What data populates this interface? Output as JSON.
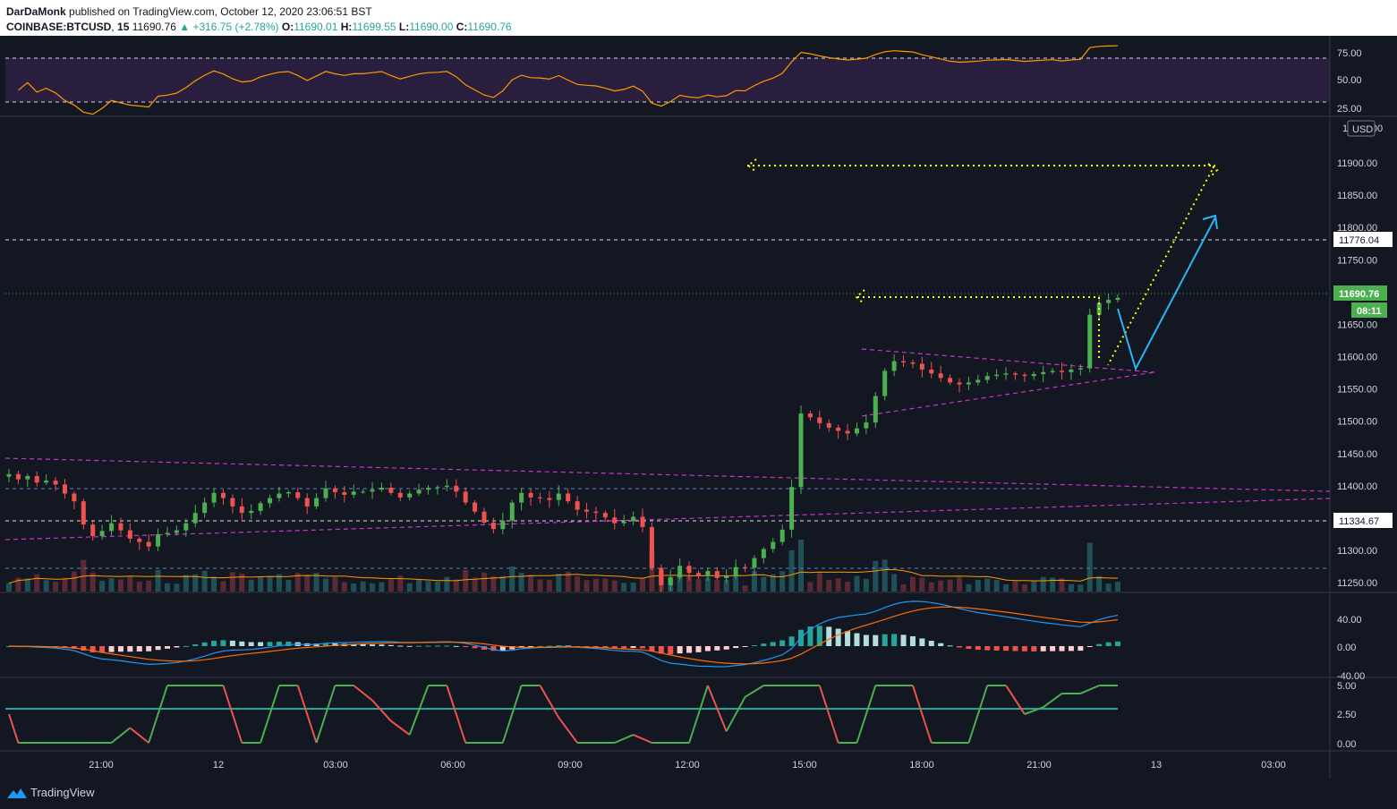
{
  "header": {
    "author": "DarDaMonk",
    "published_text": "published on TradingView.com, October 12, 2020 23:06:51 BST",
    "symbol": "COINBASE:BTCUSD",
    "interval": "15",
    "last": "11690.76",
    "change": "▲ +316.75 (+2.78%)",
    "open_label": "O:",
    "open": "11690.01",
    "high_label": "H:",
    "high": "11699.55",
    "low_label": "L:",
    "low": "11690.00",
    "close_label": "C:",
    "close": "11690.76"
  },
  "rsi_axis": [
    "75.00",
    "50.00",
    "25.00"
  ],
  "price_axis": [
    "11900.00",
    "11850.00",
    "11800.00",
    "11750.00",
    "11700.00",
    "11650.00",
    "11600.00",
    "11550.00",
    "11500.00",
    "11450.00",
    "11400.00",
    "11350.00",
    "11300.00",
    "11250.00"
  ],
  "price_axis_partial": "11950.00",
  "currency": "USD",
  "price_tags": {
    "resistance": "11776.04",
    "last": "11690.76",
    "countdown": "08:11",
    "support": "11334.67"
  },
  "macd_axis": [
    "40.00",
    "0.00",
    "-40.00"
  ],
  "osc_axis": [
    "5.00",
    "2.50",
    "0.00"
  ],
  "time_axis": [
    "21:00",
    "12",
    "03:00",
    "06:00",
    "09:00",
    "12:00",
    "15:00",
    "18:00",
    "21:00",
    "13",
    "03:00"
  ],
  "footer": {
    "brand": "TradingView"
  },
  "colors": {
    "up": "#4caf50",
    "down": "#ef5350",
    "rsi": "#ff9800",
    "triangle": "#cc33cc",
    "target": "#ffff00",
    "arrow": "#29b6f6"
  },
  "chart_data": {
    "type": "candlestick",
    "symbol": "COINBASE:BTCUSD",
    "timeframe": "15",
    "price_range": [
      11230,
      11970
    ],
    "levels": {
      "resistance": 11776.04,
      "support": 11334.67,
      "last": 11690.76
    },
    "closes": [
      11418,
      11410,
      11415,
      11405,
      11408,
      11402,
      11388,
      11376,
      11340,
      11322,
      11330,
      11342,
      11331,
      11318,
      11313,
      11306,
      11325,
      11327,
      11331,
      11342,
      11358,
      11374,
      11389,
      11381,
      11368,
      11358,
      11361,
      11373,
      11381,
      11388,
      11390,
      11381,
      11368,
      11381,
      11396,
      11390,
      11386,
      11391,
      11391,
      11394,
      11397,
      11389,
      11382,
      11388,
      11394,
      11397,
      11398,
      11400,
      11391,
      11374,
      11360,
      11343,
      11333,
      11346,
      11374,
      11389,
      11382,
      11381,
      11378,
      11388,
      11376,
      11363,
      11360,
      11358,
      11351,
      11342,
      11345,
      11352,
      11336,
      11273,
      11246,
      11258,
      11276,
      11265,
      11260,
      11268,
      11257,
      11260,
      11274,
      11273,
      11288,
      11302,
      11313,
      11332,
      11398,
      11512,
      11506,
      11497,
      11490,
      11485,
      11481,
      11489,
      11498,
      11539,
      11578,
      11593,
      11591,
      11589,
      11580,
      11574,
      11567,
      11560,
      11557,
      11560,
      11564,
      11570,
      11572,
      11574,
      11572,
      11570,
      11573,
      11576,
      11578,
      11576,
      11580,
      11582,
      11665,
      11683,
      11688,
      11691
    ]
  }
}
